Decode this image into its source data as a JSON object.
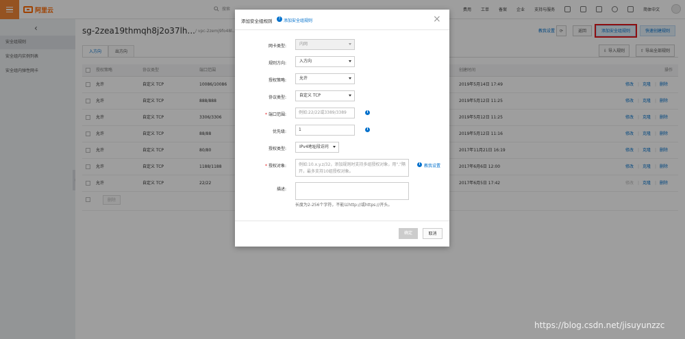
{
  "topbar": {
    "logo_text": "阿里云",
    "search_placeholder": "搜索",
    "nav": [
      "费用",
      "工单",
      "备案",
      "企业",
      "支持与服务"
    ],
    "lang": "简体中文"
  },
  "sidebar": {
    "items": [
      "安全组规则",
      "安全组内实例列表",
      "安全组内弹性网卡"
    ]
  },
  "header": {
    "title": "sg-2zea19thmqh8j2o37lh...",
    "vpc": "/ vpc-2zemj9fo48l...",
    "quick_link": "教我设置",
    "return_btn": "返回",
    "add_rule_btn": "添加安全组规则",
    "quick_create_btn": "快速创建规则"
  },
  "tabs": [
    "入方向",
    "出方向"
  ],
  "tools": {
    "import": "导入规则",
    "export": "导出全部规则"
  },
  "table": {
    "columns": [
      "授权策略",
      "协议类型",
      "端口范围",
      "创建时间",
      "操作"
    ],
    "rows": [
      {
        "policy": "允许",
        "proto": "自定义 TCP",
        "port": "10086/10086",
        "time": "2019年5月14日 17:49",
        "modify": "修改",
        "clone": "克隆",
        "delete": "删除"
      },
      {
        "policy": "允许",
        "proto": "自定义 TCP",
        "port": "888/888",
        "time": "2019年5月12日 11:25",
        "modify": "修改",
        "clone": "克隆",
        "delete": "删除"
      },
      {
        "policy": "允许",
        "proto": "自定义 TCP",
        "port": "3306/3306",
        "time": "2019年5月12日 11:25",
        "modify": "修改",
        "clone": "克隆",
        "delete": "删除"
      },
      {
        "policy": "允许",
        "proto": "自定义 TCP",
        "port": "88/88",
        "time": "2019年5月12日 11:16",
        "modify": "修改",
        "clone": "克隆",
        "delete": "删除"
      },
      {
        "policy": "允许",
        "proto": "自定义 TCP",
        "port": "80/80",
        "time": "2017年11月21日 16:19",
        "modify": "修改",
        "clone": "克隆",
        "delete": "删除"
      },
      {
        "policy": "允许",
        "proto": "自定义 TCP",
        "port": "1188/1188",
        "time": "2017年6月6日 12:00",
        "modify": "修改",
        "clone": "克隆",
        "delete": "删除"
      },
      {
        "policy": "允许",
        "proto": "自定义 TCP",
        "port": "22/22",
        "time": "2017年6月5日 17:42",
        "modify": "修改",
        "clone": "克隆",
        "delete": "删除"
      }
    ],
    "delete_btn": "删除"
  },
  "modal": {
    "title": "添加安全组规则",
    "help_link": "添加安全组规则",
    "fields": {
      "nic_label": "网卡类型:",
      "nic_value": "内网",
      "direction_label": "规则方向:",
      "direction_value": "入方向",
      "policy_label": "授权策略:",
      "policy_value": "允许",
      "protocol_label": "协议类型:",
      "protocol_value": "自定义 TCP",
      "port_label": "端口范围:",
      "port_placeholder": "例如:22/22或3389/3389",
      "priority_label": "优先级:",
      "priority_value": "1",
      "authtype_label": "授权类型:",
      "authtype_value": "IPv4地址段访问",
      "authobj_label": "授权对象:",
      "authobj_placeholder": "例如:10.x.y.z/32，添加规则时支持多组授权对象，用\",\"隔开，最多支持10组授权对象。",
      "authobj_link": "教我设置",
      "desc_label": "描述:",
      "desc_hint": "长度为2-256个字符，不能以http://或https://开头。"
    },
    "ok_btn": "确定",
    "cancel_btn": "取消"
  },
  "watermark": "https://blog.csdn.net/jisuyunzzc"
}
